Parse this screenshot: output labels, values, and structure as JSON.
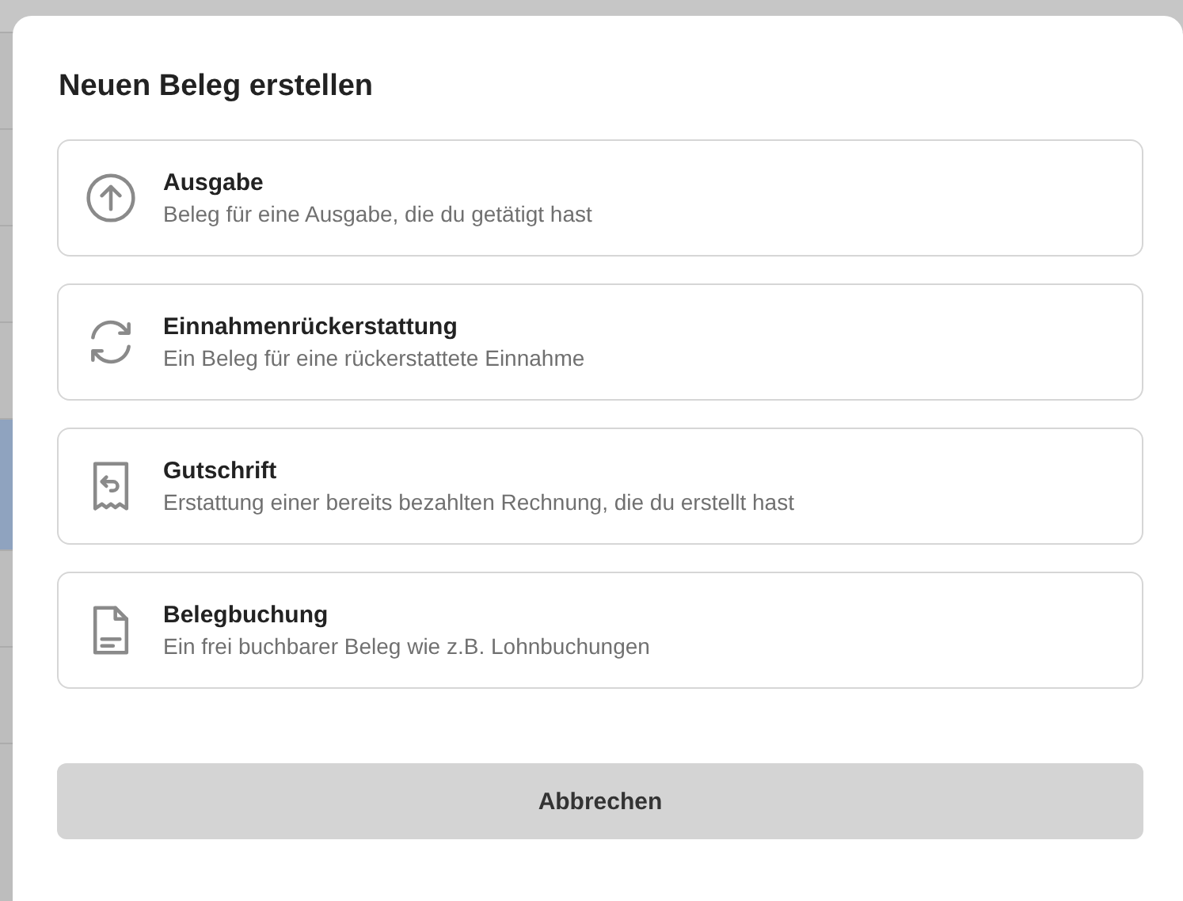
{
  "dialog": {
    "title": "Neuen Beleg erstellen",
    "options": [
      {
        "kind": "upload",
        "title": "Ausgabe",
        "description": "Beleg für eine Ausgabe, die du getätigt hast"
      },
      {
        "kind": "refresh",
        "title": "Einnahmenrückerstattung",
        "description": "Ein Beleg für eine rückerstattete Einnahme"
      },
      {
        "kind": "receipt",
        "title": "Gutschrift",
        "description": "Erstattung einer bereits bezahlten Rechnung, die du erstellt hast"
      },
      {
        "kind": "document",
        "title": "Belegbuchung",
        "description": "Ein frei buchbarer Beleg wie z.B. Lohnbuchungen"
      }
    ],
    "cancel_button": "Abbrechen"
  }
}
